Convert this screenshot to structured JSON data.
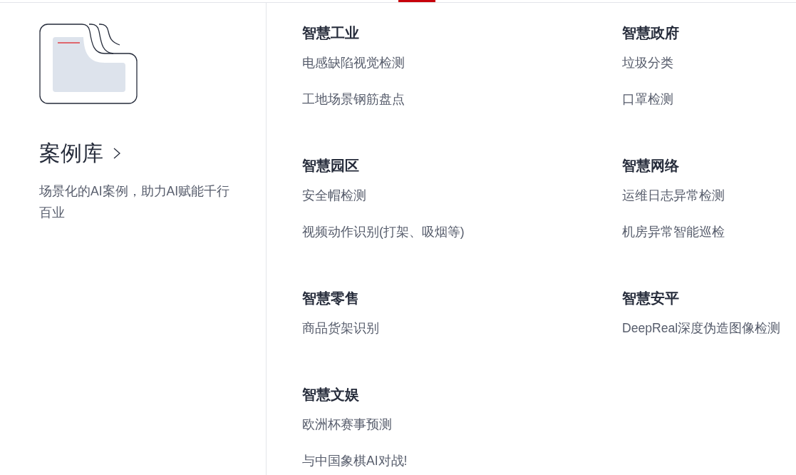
{
  "intro": {
    "title": "案例库",
    "description": "场景化的AI案例，助力AI赋能千行百业"
  },
  "categories": [
    {
      "title": "智慧工业",
      "items": [
        "电感缺陷视觉检测",
        "工地场景钢筋盘点"
      ]
    },
    {
      "title": "智慧政府",
      "items": [
        "垃圾分类",
        "口罩检测"
      ]
    },
    {
      "title": "智慧园区",
      "items": [
        "安全帽检测",
        "视频动作识别(打架、吸烟等)"
      ]
    },
    {
      "title": "智慧网络",
      "items": [
        "运维日志异常检测",
        "机房异常智能巡检"
      ]
    },
    {
      "title": "智慧零售",
      "items": [
        "商品货架识别"
      ]
    },
    {
      "title": "智慧安平",
      "items": [
        "DeepReal深度伪造图像检测"
      ]
    },
    {
      "title": "智慧文娱",
      "items": [
        "欧洲杯赛事预测",
        "与中国象棋AI对战!"
      ]
    }
  ]
}
